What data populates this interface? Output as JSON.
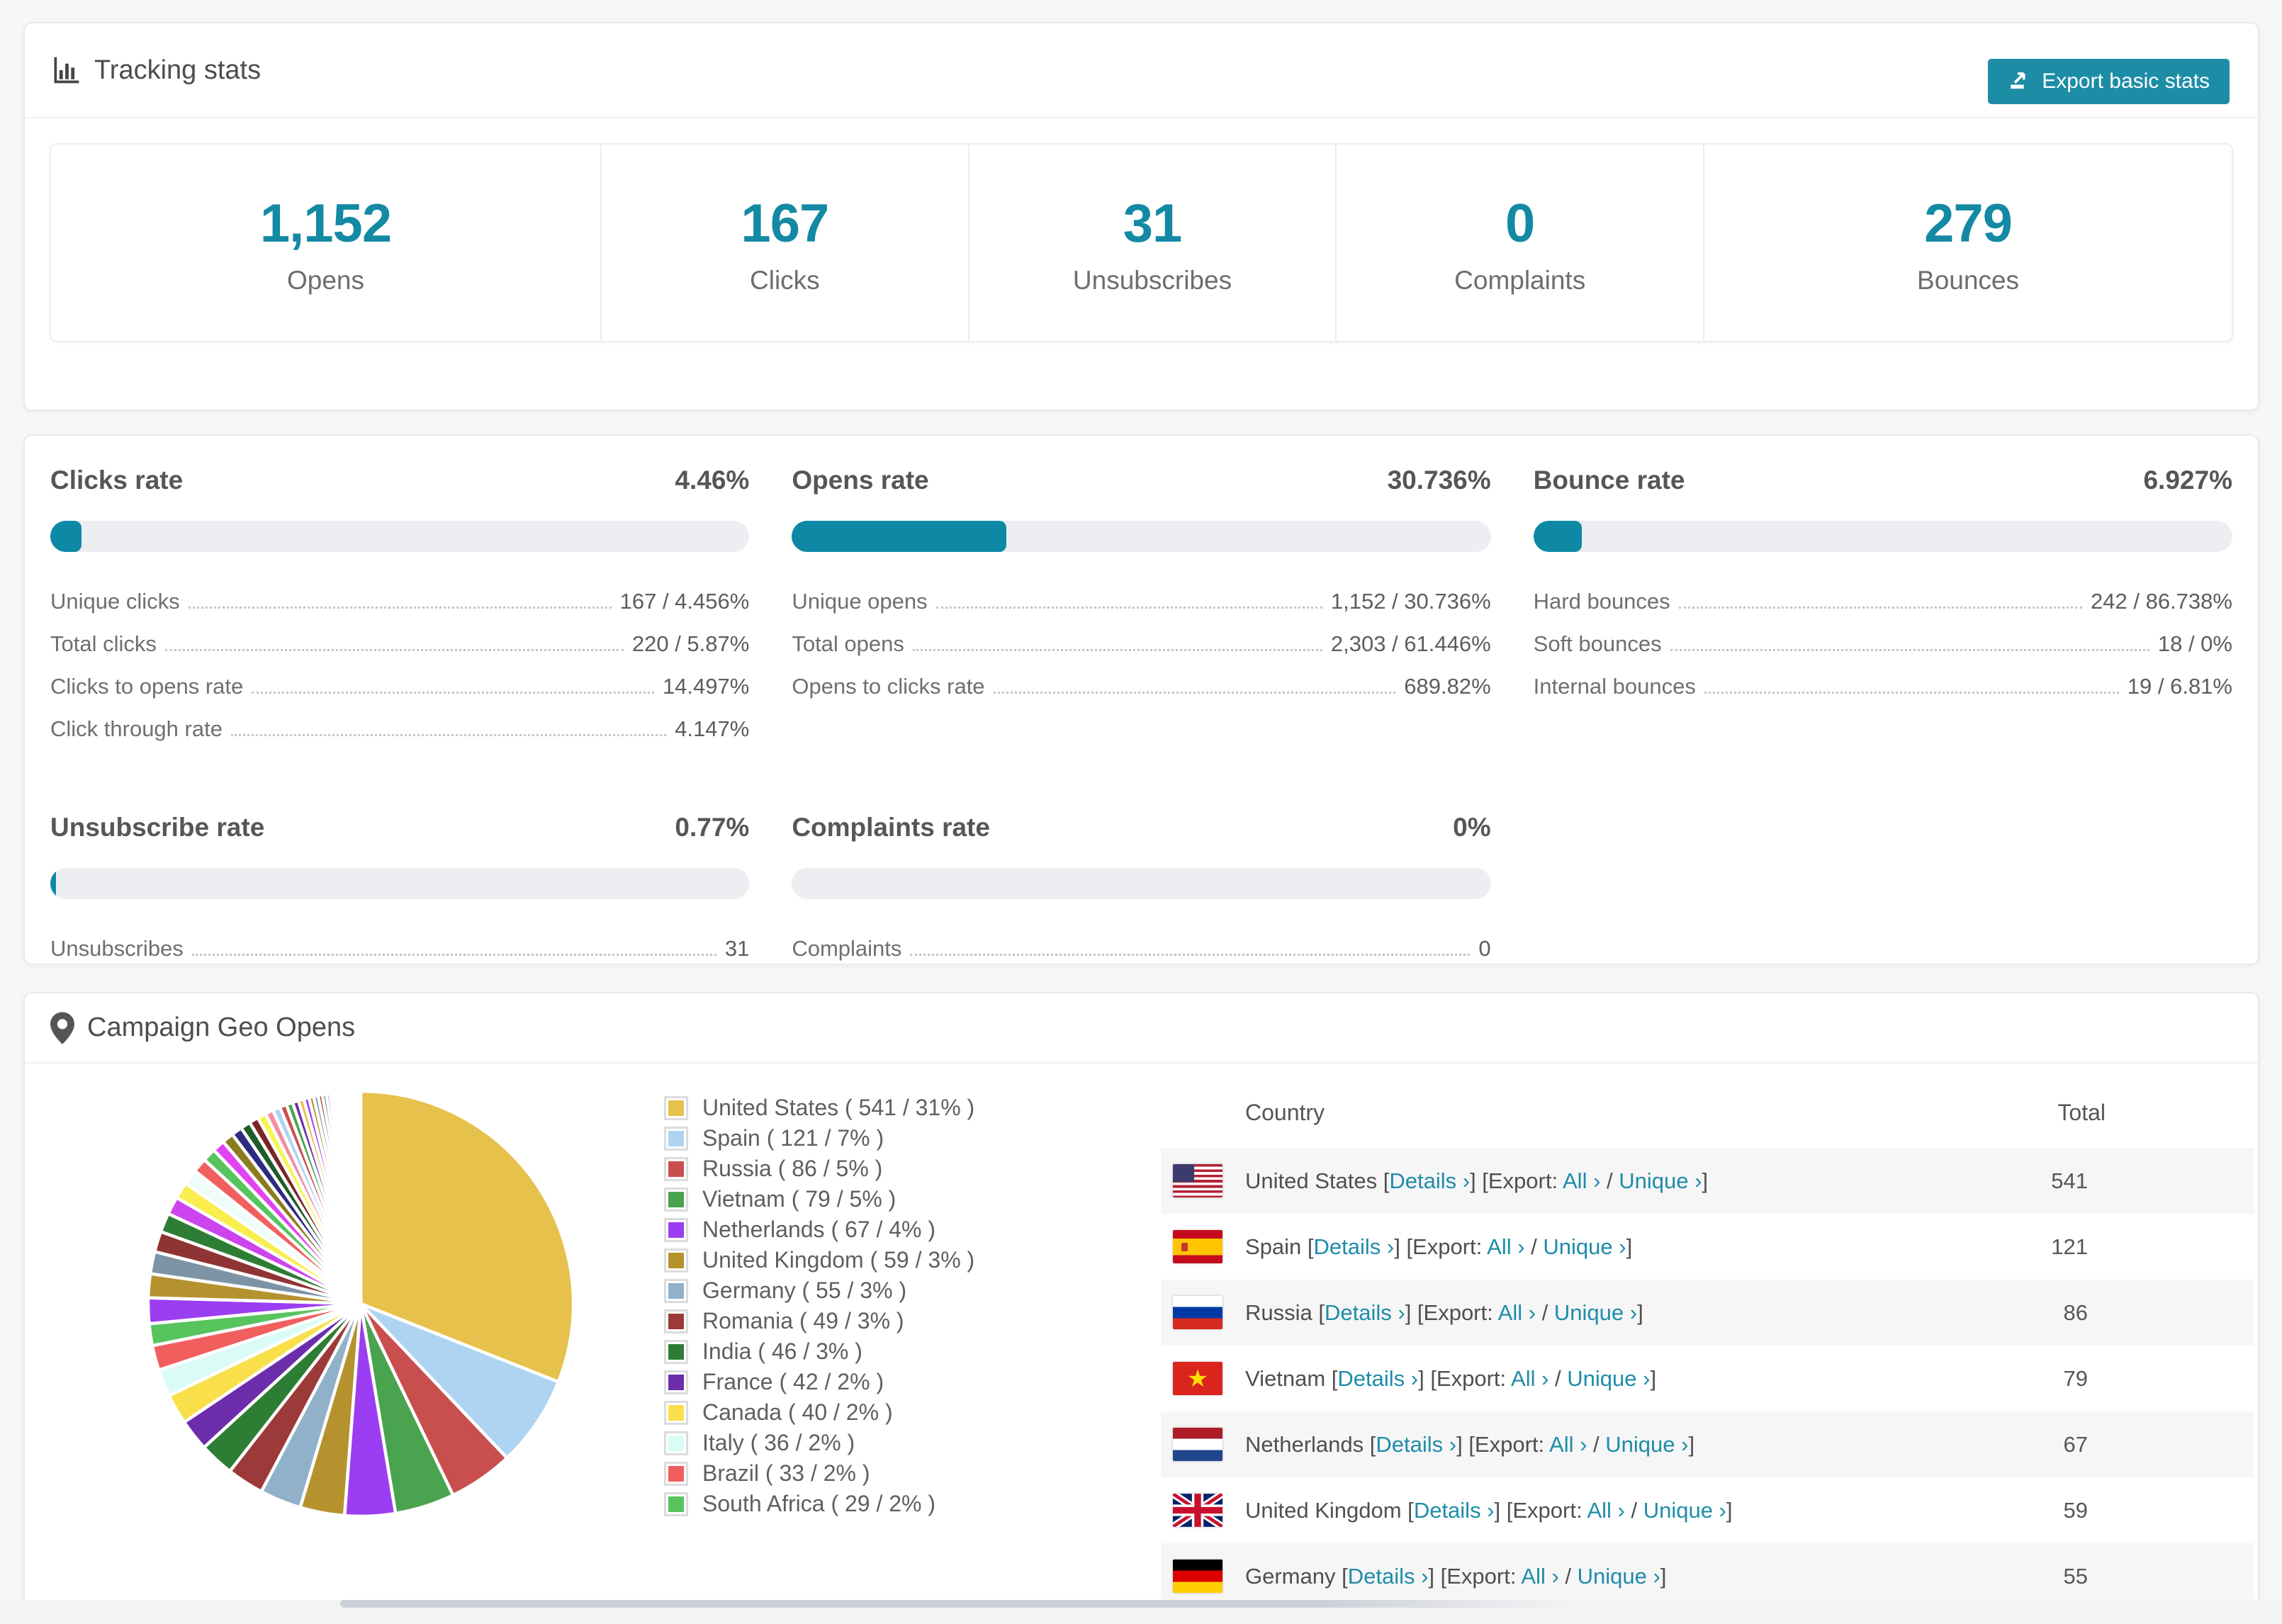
{
  "accent": "#1489a4",
  "header": {
    "title": "Tracking stats",
    "export_label": "Export basic stats"
  },
  "stats": {
    "items": [
      {
        "value": "1,152",
        "label": "Opens"
      },
      {
        "value": "167",
        "label": "Clicks"
      },
      {
        "value": "31",
        "label": "Unsubscribes"
      },
      {
        "value": "0",
        "label": "Complaints"
      },
      {
        "value": "279",
        "label": "Bounces"
      }
    ]
  },
  "rates": {
    "blocks": [
      {
        "title": "Clicks rate",
        "pct_label": "4.46%",
        "bar_pct": 4.46,
        "rows": [
          {
            "label": "Unique clicks",
            "value": "167 / 4.456%"
          },
          {
            "label": "Total clicks",
            "value": "220 / 5.87%"
          },
          {
            "label": "Clicks to opens rate",
            "value": "14.497%"
          },
          {
            "label": "Click through rate",
            "value": "4.147%"
          }
        ]
      },
      {
        "title": "Opens rate",
        "pct_label": "30.736%",
        "bar_pct": 30.736,
        "rows": [
          {
            "label": "Unique opens",
            "value": "1,152 / 30.736%"
          },
          {
            "label": "Total opens",
            "value": "2,303 / 61.446%"
          },
          {
            "label": "Opens to clicks rate",
            "value": "689.82%"
          }
        ]
      },
      {
        "title": "Bounce rate",
        "pct_label": "6.927%",
        "bar_pct": 6.927,
        "rows": [
          {
            "label": "Hard bounces",
            "value": "242 / 86.738%"
          },
          {
            "label": "Soft bounces",
            "value": "18 / 0%"
          },
          {
            "label": "Internal bounces",
            "value": "19 / 6.81%"
          }
        ]
      },
      {
        "title": "Unsubscribe rate",
        "pct_label": "0.77%",
        "bar_pct": 0.77,
        "rows": [
          {
            "label": "Unsubscribes",
            "value": "31"
          }
        ]
      },
      {
        "title": "Complaints rate",
        "pct_label": "0%",
        "bar_pct": 0,
        "rows": [
          {
            "label": "Complaints",
            "value": "0"
          }
        ]
      }
    ]
  },
  "geo": {
    "title": "Campaign Geo Opens",
    "chart_data": {
      "type": "pie",
      "title": "Campaign Geo Opens",
      "legend_position": "right",
      "slices": [
        {
          "name": "United States",
          "value": 541,
          "pct": "31",
          "color": "#e6c14b"
        },
        {
          "name": "Spain",
          "value": 121,
          "pct": "7",
          "color": "#aed4f2"
        },
        {
          "name": "Russia",
          "value": 86,
          "pct": "5",
          "color": "#c94f4f"
        },
        {
          "name": "Vietnam",
          "value": 79,
          "pct": "5",
          "color": "#4aa34f"
        },
        {
          "name": "Netherlands",
          "value": 67,
          "pct": "4",
          "color": "#9b3ef2"
        },
        {
          "name": "United Kingdom",
          "value": 59,
          "pct": "3",
          "color": "#b5922d"
        },
        {
          "name": "Germany",
          "value": 55,
          "pct": "3",
          "color": "#90b1c9"
        },
        {
          "name": "Romania",
          "value": 49,
          "pct": "3",
          "color": "#9c3a39"
        },
        {
          "name": "India",
          "value": 46,
          "pct": "3",
          "color": "#2e7d34"
        },
        {
          "name": "France",
          "value": 42,
          "pct": "2",
          "color": "#6c2daa"
        },
        {
          "name": "Canada",
          "value": 40,
          "pct": "2",
          "color": "#f9e04b"
        },
        {
          "name": "Italy",
          "value": 36,
          "pct": "2",
          "color": "#dbfcf6"
        },
        {
          "name": "Brazil",
          "value": 33,
          "pct": "2",
          "color": "#f15e5e"
        },
        {
          "name": "South Africa",
          "value": 29,
          "pct": "2",
          "color": "#57c45e"
        }
      ],
      "others_pct": 26.5,
      "tail_colors": [
        "#9b3ef2",
        "#b5922d",
        "#7d93a6",
        "#8e3434",
        "#2e7d34",
        "#cc44ee",
        "#f9ee4e",
        "#eefcfa",
        "#f15e5e",
        "#57c45e",
        "#e044f0",
        "#8a7d20",
        "#2d2a80",
        "#1e5c28",
        "#7a2525",
        "#f6f64e",
        "#f58ca0",
        "#aed4f2",
        "#c94f4f",
        "#4aa34f",
        "#6c2daa",
        "#e6c14b"
      ]
    },
    "table": {
      "col_country": "Country",
      "col_total": "Total",
      "link_details": "Details ›",
      "export_prefix": "Export:",
      "link_all": "All ›",
      "link_unique": "Unique ›",
      "rows": [
        {
          "flag": "us",
          "country": "United States",
          "total": "541"
        },
        {
          "flag": "es",
          "country": "Spain",
          "total": "121"
        },
        {
          "flag": "ru",
          "country": "Russia",
          "total": "86"
        },
        {
          "flag": "vn",
          "country": "Vietnam",
          "total": "79"
        },
        {
          "flag": "nl",
          "country": "Netherlands",
          "total": "67"
        },
        {
          "flag": "gb",
          "country": "United Kingdom",
          "total": "59"
        },
        {
          "flag": "de",
          "country": "Germany",
          "total": "55"
        }
      ]
    }
  }
}
